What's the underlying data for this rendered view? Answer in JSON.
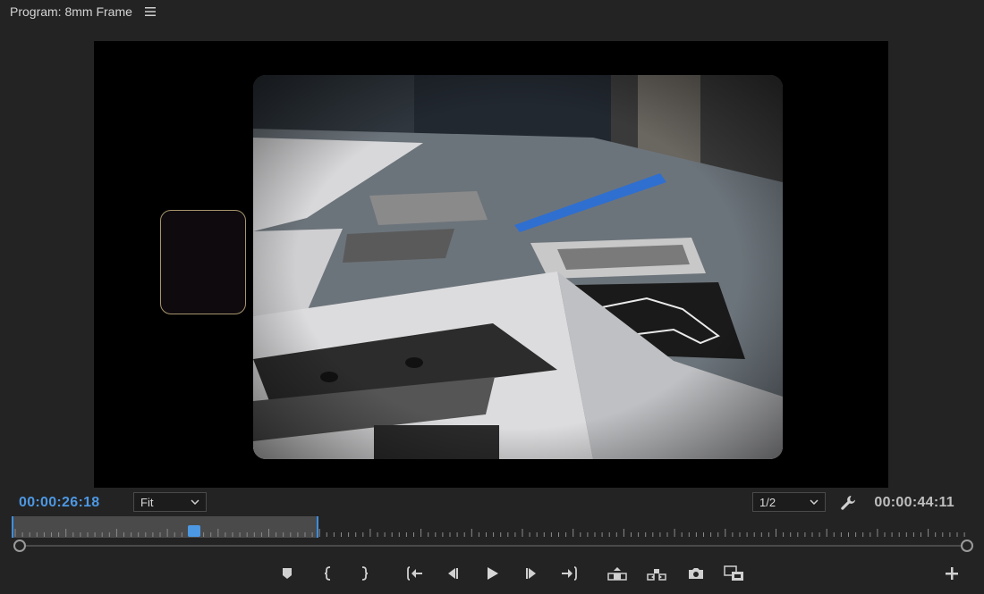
{
  "panel": {
    "title": "Program: 8mm Frame"
  },
  "timecode": {
    "current": "00:00:26:18",
    "duration": "00:00:44:11"
  },
  "zoom": {
    "selected": "Fit"
  },
  "resolution": {
    "selected": "1/2"
  },
  "playback": {
    "playhead_position_fraction": 0.19,
    "work_area_end_fraction": 0.32
  },
  "transport_controls": [
    {
      "name": "add-marker-button",
      "icon": "marker-icon"
    },
    {
      "name": "mark-in-button",
      "icon": "mark-in-icon"
    },
    {
      "name": "mark-out-button",
      "icon": "mark-out-icon"
    },
    {
      "name": "go-to-in-button",
      "icon": "go-to-in-icon"
    },
    {
      "name": "step-back-button",
      "icon": "step-back-icon"
    },
    {
      "name": "play-button",
      "icon": "play-icon"
    },
    {
      "name": "step-forward-button",
      "icon": "step-forward-icon"
    },
    {
      "name": "go-to-out-button",
      "icon": "go-to-out-icon"
    },
    {
      "name": "lift-button",
      "icon": "lift-icon"
    },
    {
      "name": "extract-button",
      "icon": "extract-icon"
    },
    {
      "name": "export-frame-button",
      "icon": "camera-icon"
    },
    {
      "name": "comparison-view-button",
      "icon": "comparison-view-icon"
    },
    {
      "name": "button-editor-button",
      "icon": "plus-icon"
    }
  ],
  "colors": {
    "accent": "#4d98e3",
    "background": "#232323",
    "viewer": "#000000"
  }
}
